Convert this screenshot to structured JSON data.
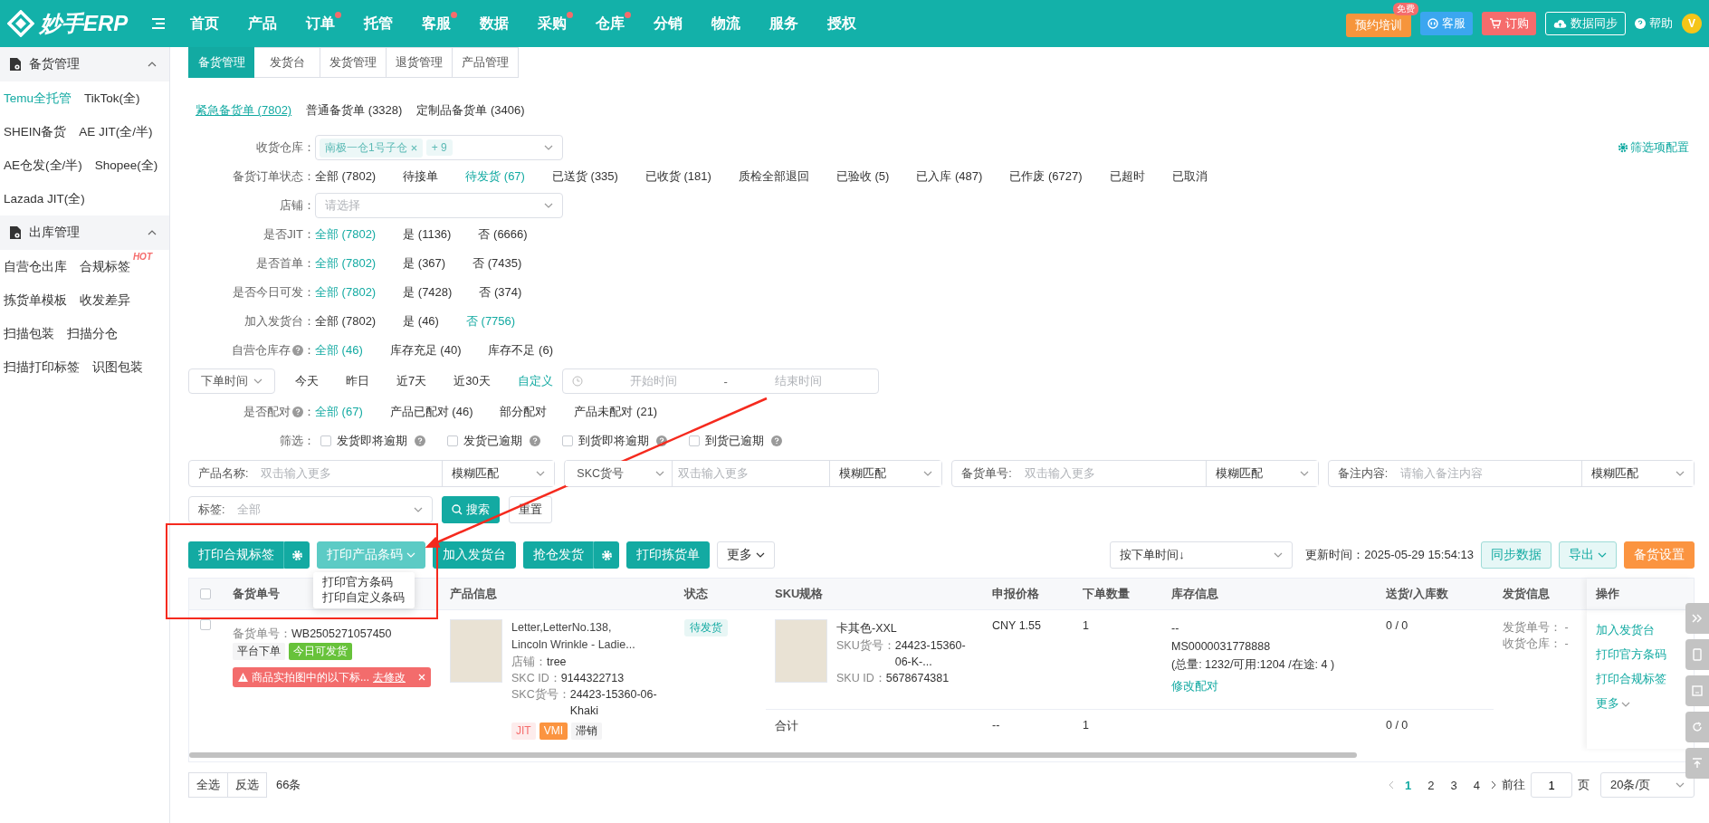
{
  "header": {
    "logo": "妙手ERP",
    "nav": [
      {
        "label": "首页",
        "dot": false
      },
      {
        "label": "产品",
        "dot": false
      },
      {
        "label": "订单",
        "dot": true
      },
      {
        "label": "托管",
        "dot": false
      },
      {
        "label": "客服",
        "dot": true
      },
      {
        "label": "数据",
        "dot": false
      },
      {
        "label": "采购",
        "dot": true
      },
      {
        "label": "仓库",
        "dot": true
      },
      {
        "label": "分销",
        "dot": false
      },
      {
        "label": "物流",
        "dot": false
      },
      {
        "label": "服务",
        "dot": false
      },
      {
        "label": "授权",
        "dot": false
      }
    ],
    "training": {
      "label": "预约培训",
      "badge": "免费"
    },
    "service": "客服",
    "order": "订购",
    "sync": "数据同步",
    "help": "帮助",
    "avatar": "V"
  },
  "sidebar": {
    "sections": [
      {
        "title": "备货管理",
        "expanded": true,
        "items": [
          {
            "label": "Temu全托管",
            "selected": true
          },
          {
            "label": "TikTok(全)",
            "selected": false
          },
          {
            "label": "SHEIN备货",
            "selected": false
          },
          {
            "label": "AE JIT(全/半)",
            "selected": false
          },
          {
            "label": "AE仓发(全/半)",
            "selected": false
          },
          {
            "label": "Shopee(全)",
            "selected": false
          },
          {
            "label": "Lazada JIT(全)",
            "selected": false
          }
        ]
      },
      {
        "title": "出库管理",
        "expanded": true,
        "items": [
          {
            "label": "自营仓出库",
            "selected": false
          },
          {
            "label": "合规标签",
            "selected": false,
            "badge": "HOT"
          },
          {
            "label": "拣货单模板",
            "selected": false
          },
          {
            "label": "收发差异",
            "selected": false
          },
          {
            "label": "扫描包装",
            "selected": false
          },
          {
            "label": "扫描分仓",
            "selected": false
          },
          {
            "label": "扫描打印标签",
            "selected": false
          },
          {
            "label": "识图包装",
            "selected": false
          }
        ]
      }
    ]
  },
  "tabs": [
    {
      "label": "备货管理",
      "selected": true
    },
    {
      "label": "发货台",
      "selected": false
    },
    {
      "label": "发货管理",
      "selected": false
    },
    {
      "label": "退货管理",
      "selected": false
    },
    {
      "label": "产品管理",
      "selected": false
    }
  ],
  "order_types": [
    {
      "label": "紧急备货单 (7802)",
      "selected": true
    },
    {
      "label": "普通备货单 (3328)",
      "selected": false
    },
    {
      "label": "定制品备货单 (3406)",
      "selected": false
    }
  ],
  "config_link": "筛选项配置",
  "filters": [
    {
      "kind": "select",
      "label": "收货仓库",
      "colon": "：",
      "help": false,
      "tags": [
        "南极一仓1号子仓",
        "+ 9"
      ]
    },
    {
      "kind": "options",
      "label": "备货订单状态",
      "colon": "：",
      "help": false,
      "options": [
        {
          "label": "全部 (7802)",
          "selected": false
        },
        {
          "label": "待接单",
          "selected": false
        },
        {
          "label": "待发货 (67)",
          "selected": true
        },
        {
          "label": "已送货 (335)",
          "selected": false
        },
        {
          "label": "已收货 (181)",
          "selected": false
        },
        {
          "label": "质检全部退回",
          "selected": false
        },
        {
          "label": "已验收 (5)",
          "selected": false
        },
        {
          "label": "已入库 (487)",
          "selected": false
        },
        {
          "label": "已作废 (6727)",
          "selected": false
        },
        {
          "label": "已超时",
          "selected": false
        },
        {
          "label": "已取消",
          "selected": false
        }
      ]
    },
    {
      "kind": "select",
      "label": "店铺",
      "colon": "：",
      "help": false,
      "placeholder": "请选择"
    },
    {
      "kind": "options",
      "label": "是否JIT",
      "colon": "：",
      "help": false,
      "options": [
        {
          "label": "全部 (7802)",
          "selected": true
        },
        {
          "label": "是 (1136)",
          "selected": false
        },
        {
          "label": "否 (6666)",
          "selected": false
        }
      ]
    },
    {
      "kind": "options",
      "label": "是否首单",
      "colon": "：",
      "help": false,
      "options": [
        {
          "label": "全部 (7802)",
          "selected": true
        },
        {
          "label": "是 (367)",
          "selected": false
        },
        {
          "label": "否 (7435)",
          "selected": false
        }
      ]
    },
    {
      "kind": "options",
      "label": "是否今日可发",
      "colon": "：",
      "help": false,
      "options": [
        {
          "label": "全部 (7802)",
          "selected": true
        },
        {
          "label": "是 (7428)",
          "selected": false
        },
        {
          "label": "否 (374)",
          "selected": false
        }
      ]
    },
    {
      "kind": "options",
      "label": "加入发货台",
      "colon": "：",
      "help": false,
      "options": [
        {
          "label": "全部 (7802)",
          "selected": false
        },
        {
          "label": "是 (46)",
          "selected": false
        },
        {
          "label": "否 (7756)",
          "selected": true
        }
      ]
    },
    {
      "kind": "options",
      "label": "自营仓库存",
      "colon": "：",
      "help": true,
      "options": [
        {
          "label": "全部 (46)",
          "selected": true
        },
        {
          "label": "库存充足 (40)",
          "selected": false
        },
        {
          "label": "库存不足 (6)",
          "selected": false
        }
      ]
    },
    {
      "kind": "time",
      "select": "下单时间",
      "options": [
        {
          "label": "今天",
          "selected": false
        },
        {
          "label": "昨日",
          "selected": false
        },
        {
          "label": "近7天",
          "selected": false
        },
        {
          "label": "近30天",
          "selected": false
        },
        {
          "label": "自定义",
          "selected": true
        }
      ],
      "start_placeholder": "开始时间",
      "separator": "-",
      "end_placeholder": "结束时间"
    },
    {
      "kind": "options",
      "label": "是否配对",
      "colon": "：",
      "help": true,
      "options": [
        {
          "label": "全部 (67)",
          "selected": true
        },
        {
          "label": "产品已配对 (46)",
          "selected": false
        },
        {
          "label": "部分配对",
          "selected": false
        },
        {
          "label": "产品未配对 (21)",
          "selected": false
        }
      ]
    },
    {
      "kind": "checks",
      "label": "筛选",
      "colon": "：",
      "help": false,
      "checks": [
        {
          "label": "发货即将逾期",
          "checked": false
        },
        {
          "label": "发货已逾期",
          "checked": false
        },
        {
          "label": "到货即将逾期",
          "checked": false
        },
        {
          "label": "到货已逾期",
          "checked": false
        }
      ]
    }
  ],
  "search_fields": [
    {
      "kind": "label",
      "label": "产品名称:",
      "placeholder": "双击输入更多",
      "match": "模糊匹配"
    },
    {
      "kind": "select",
      "label": "SKC货号",
      "placeholder": "双击输入更多",
      "match": "模糊匹配"
    },
    {
      "kind": "label",
      "label": "备货单号:",
      "placeholder": "双击输入更多",
      "match": "模糊匹配"
    },
    {
      "kind": "label",
      "label": "备注内容:",
      "placeholder": "请输入备注内容",
      "match": "模糊匹配"
    }
  ],
  "tag_filter": {
    "label": "标签:",
    "placeholder": "全部"
  },
  "search_button": "搜索",
  "reset_button": "重置",
  "actions": [
    {
      "label": "打印合规标签",
      "kind": "primary",
      "gear": true,
      "caret": false,
      "open": false
    },
    {
      "label": "打印产品条码",
      "kind": "primary",
      "gear": false,
      "caret": true,
      "open": true,
      "menu": [
        "打印官方条码",
        "打印自定义条码"
      ]
    },
    {
      "label": "加入发货台",
      "kind": "primary",
      "gear": false,
      "caret": false,
      "open": false
    },
    {
      "label": "抢仓发货",
      "kind": "primary",
      "gear": true,
      "caret": false,
      "open": false
    },
    {
      "label": "打印拣货单",
      "kind": "primary",
      "gear": false,
      "caret": false,
      "open": false
    },
    {
      "label": "更多",
      "kind": "plain",
      "gear": false,
      "caret": true,
      "open": false
    }
  ],
  "sort_select": "按下单时间↓",
  "update_label": "更新时间：",
  "update_time": "2025-05-29 15:54:13",
  "right_buttons": [
    {
      "label": "同步数据",
      "kind": "soft",
      "caret": false
    },
    {
      "label": "导出",
      "kind": "soft",
      "caret": true
    },
    {
      "label": "备货设置",
      "kind": "orange",
      "caret": false
    }
  ],
  "table": {
    "select_all_checked": false,
    "columns": [
      "备货单号",
      "产品信息",
      "状态",
      "SKU规格",
      "申报价格",
      "下单数量",
      "库存信息",
      "送货/入库数",
      "发货信息",
      "操作"
    ],
    "rows": [
      {
        "checked": false,
        "order_label": "备货单号：",
        "order_no": "WB2505271057450",
        "tags": [
          {
            "label": "平台下单",
            "kind": "plain"
          },
          {
            "label": "今日可发货",
            "kind": "green"
          }
        ],
        "alert": {
          "text": "商品实拍图中的以下标...",
          "link": "去修改"
        },
        "product": {
          "title": "Letter,LetterNo.138, Lincoln Wrinkle - Ladie...",
          "fields": [
            {
              "label": "店铺：",
              "value": "tree"
            },
            {
              "label": "SKC ID：",
              "value": "9144322713"
            },
            {
              "label": "SKC货号：",
              "value": "24423-15360-06-Khaki"
            }
          ],
          "tags": [
            {
              "label": "JIT",
              "kind": "jit"
            },
            {
              "label": "VMI",
              "kind": "vmi"
            },
            {
              "label": "滞销",
              "kind": "plain"
            }
          ]
        },
        "status": "待发货",
        "sku": {
          "name": "卡其色-XXL",
          "fields": [
            {
              "label": "SKU货号：",
              "value": "24423-15360-06-K-..."
            },
            {
              "label": "SKU ID：",
              "value": "5678674381"
            }
          ]
        },
        "price": "CNY 1.55",
        "qty": "1",
        "stock": {
          "lines": [
            "--",
            "MS0000031778888",
            "(总量: 1232/可用:1204 /在途: 4 )"
          ],
          "link": "修改配对"
        },
        "delivery": "0 / 0",
        "shipping": [
          "发货单号： -",
          "收货仓库： -"
        ],
        "ops": [
          "加入发货台",
          "打印官方条码",
          "打印合规标签"
        ],
        "ops_more": "更多"
      }
    ],
    "total": {
      "label": "合计",
      "price": "--",
      "qty": "1",
      "delivery": "0 / 0"
    }
  },
  "footer": {
    "select_all": "全选",
    "invert": "反选",
    "count": "66条",
    "pages": [
      {
        "label": "1",
        "selected": true
      },
      {
        "label": "2",
        "selected": false
      },
      {
        "label": "3",
        "selected": false
      },
      {
        "label": "4",
        "selected": false
      }
    ],
    "goto": "前往",
    "page_value": "1",
    "page_unit": "页",
    "page_size": "20条/页"
  }
}
